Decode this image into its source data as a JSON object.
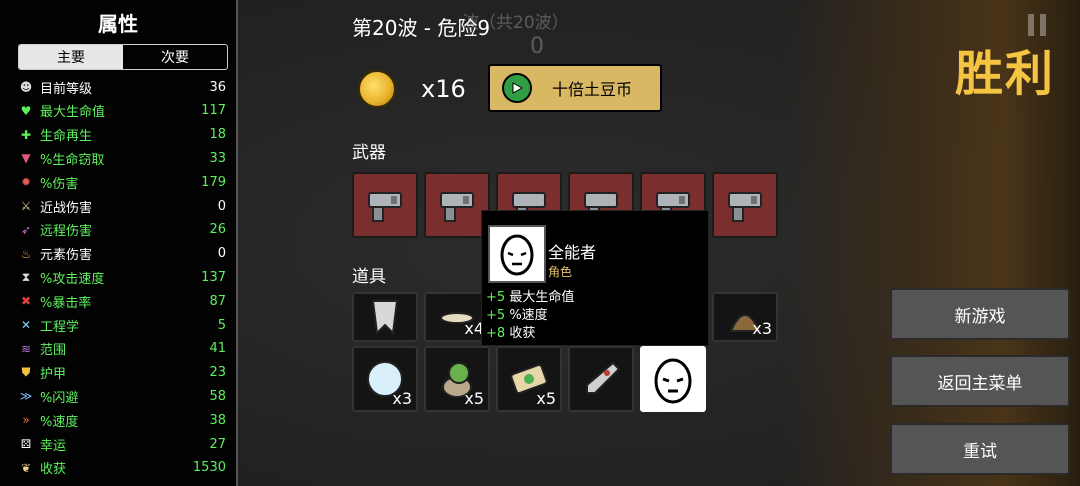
{
  "stats": {
    "title": "属性",
    "tabs": [
      "主要",
      "次要"
    ],
    "items": [
      {
        "name": "目前等级",
        "value": "36",
        "color": "white",
        "icon": "level-icon"
      },
      {
        "name": "最大生命值",
        "value": "117",
        "color": "green",
        "icon": "heart-icon"
      },
      {
        "name": "生命再生",
        "value": "18",
        "color": "green",
        "icon": "regen-icon"
      },
      {
        "name": "%生命窃取",
        "value": "33",
        "color": "green",
        "icon": "fangs-icon"
      },
      {
        "name": "%伤害",
        "value": "179",
        "color": "green",
        "icon": "damage-icon"
      },
      {
        "name": "近战伤害",
        "value": "0",
        "color": "white",
        "icon": "sword-icon"
      },
      {
        "name": "远程伤害",
        "value": "26",
        "color": "green",
        "icon": "bow-icon"
      },
      {
        "name": "元素伤害",
        "value": "0",
        "color": "white",
        "icon": "flame-icon"
      },
      {
        "name": "%攻击速度",
        "value": "137",
        "color": "green",
        "icon": "hourglass-icon"
      },
      {
        "name": "%暴击率",
        "value": "87",
        "color": "green",
        "icon": "crit-icon"
      },
      {
        "name": "工程学",
        "value": "5",
        "color": "green",
        "icon": "wrench-icon"
      },
      {
        "name": "范围",
        "value": "41",
        "color": "green",
        "icon": "range-icon"
      },
      {
        "name": "护甲",
        "value": "23",
        "color": "green",
        "icon": "shield-icon"
      },
      {
        "name": "%闪避",
        "value": "58",
        "color": "green",
        "icon": "dodge-icon"
      },
      {
        "name": "%速度",
        "value": "38",
        "color": "green",
        "icon": "boot-icon"
      },
      {
        "name": "幸运",
        "value": "27",
        "color": "green",
        "icon": "dice-icon"
      },
      {
        "name": "收获",
        "value": "1530",
        "color": "green",
        "icon": "harvest-icon"
      }
    ]
  },
  "wave": {
    "title": "第20波 - 危险9",
    "ghost_text": "波（共20波）",
    "ghost_number": "0"
  },
  "coins": {
    "count": "x16",
    "button_label": "十倍土豆币"
  },
  "sections": {
    "weapons": "武器",
    "items": "道具"
  },
  "item_quantities": {
    "row1_b": "x4",
    "row1_e": "x3",
    "row2_a": "x3",
    "row2_b": "x5",
    "row2_c": "x5"
  },
  "tooltip": {
    "name": "全能者",
    "type": "角色",
    "lines": [
      {
        "value": "+5",
        "label": "最大生命值"
      },
      {
        "value": "+5",
        "label": "%速度"
      },
      {
        "value": "+8",
        "label": "收获"
      }
    ]
  },
  "result": {
    "title": "胜利"
  },
  "actions": {
    "new_game": "新游戏",
    "main_menu": "返回主菜单",
    "retry": "重试"
  }
}
